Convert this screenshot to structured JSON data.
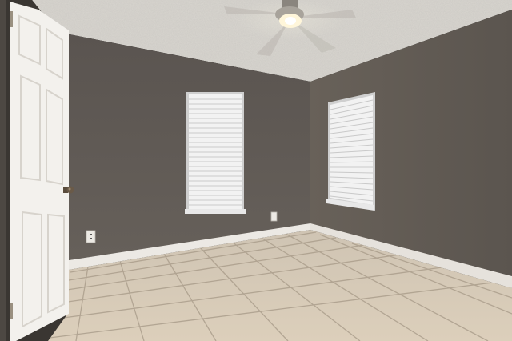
{
  "scene": {
    "kind": "empty-room-photo",
    "elements": [
      "textured-ceiling",
      "ceiling-fan",
      "left-wall",
      "back-wall",
      "right-wall",
      "window-with-blinds",
      "window-with-blinds",
      "open-door",
      "door-knob",
      "baseboards",
      "tile-floor",
      "electrical-outlet",
      "electrical-outlet"
    ]
  },
  "colors": {
    "ceiling": "#d9d6d0",
    "wall_back": "#5f5954",
    "wall_right": "#635c56",
    "wall_left": "#4d4843",
    "baseboard": "#ece9e4",
    "floor": "#d6c9b6",
    "grout": "#a99c8a",
    "window_light": "#f2f2f2",
    "door": "#f3f1ed",
    "knob": "#6a5a48"
  }
}
